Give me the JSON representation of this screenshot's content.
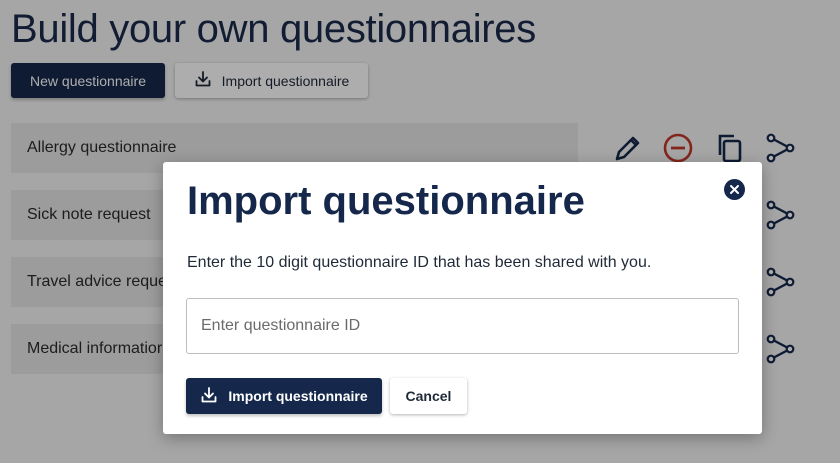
{
  "page": {
    "title": "Build your own questionnaires",
    "new_button": "New questionnaire",
    "import_button": "Import questionnaire"
  },
  "questionnaires": [
    {
      "name": "Allergy questionnaire"
    },
    {
      "name": "Sick note request"
    },
    {
      "name": "Travel advice reque"
    },
    {
      "name": "Medical informatior"
    }
  ],
  "icons": [
    "pencil-icon",
    "remove-circle-icon",
    "copy-icon",
    "share-icon",
    "download-icon",
    "close-icon"
  ],
  "colors": {
    "primary": "#15284b",
    "danger": "#c0392b",
    "row_bg": "#e6e6e6"
  },
  "modal": {
    "title": "Import questionnaire",
    "description": "Enter the 10 digit questionnaire ID that has been shared with you.",
    "input_placeholder": "Enter questionnaire ID",
    "input_value": "",
    "import_button": "Import questionnaire",
    "cancel_button": "Cancel"
  }
}
